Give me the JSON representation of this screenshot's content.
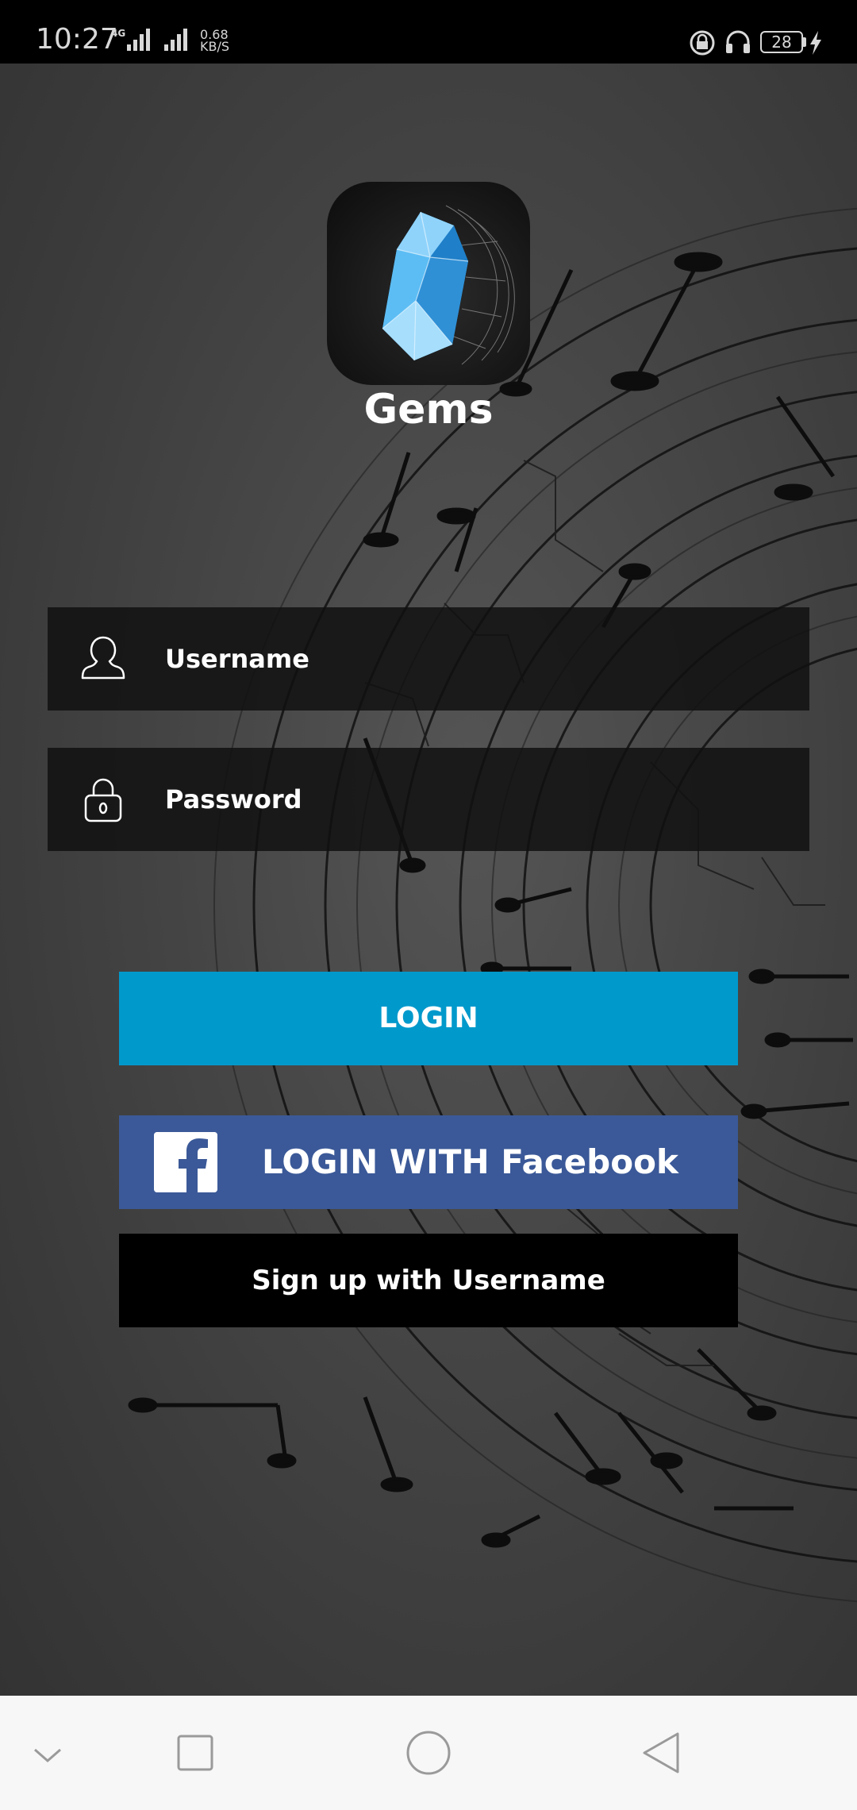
{
  "status_bar": {
    "time": "10:27",
    "network_type": "4G",
    "data_speed_value": "0.68",
    "data_speed_unit": "KB/S",
    "battery_level": "28",
    "icons": [
      "signal-icon",
      "signal-icon",
      "rotation-lock-icon",
      "headset-icon",
      "battery-icon",
      "charging-bolt-icon"
    ]
  },
  "app": {
    "name": "Gems",
    "icon": "gem-crystal-icon"
  },
  "form": {
    "username_placeholder": "Username",
    "password_placeholder": "Password",
    "username_icon": "user-icon",
    "password_icon": "padlock-icon"
  },
  "buttons": {
    "login_label": "LOGIN",
    "facebook_label": "LOGIN WITH Facebook",
    "signup_label": "Sign up with Username"
  },
  "nav_bar": {
    "icons": [
      "chevron-down-icon",
      "recents-square-icon",
      "home-circle-icon",
      "back-triangle-icon"
    ]
  },
  "colors": {
    "login_button": "#0099cc",
    "facebook_button": "#3b5998",
    "signup_button": "#000000",
    "field_background": "#101010"
  }
}
